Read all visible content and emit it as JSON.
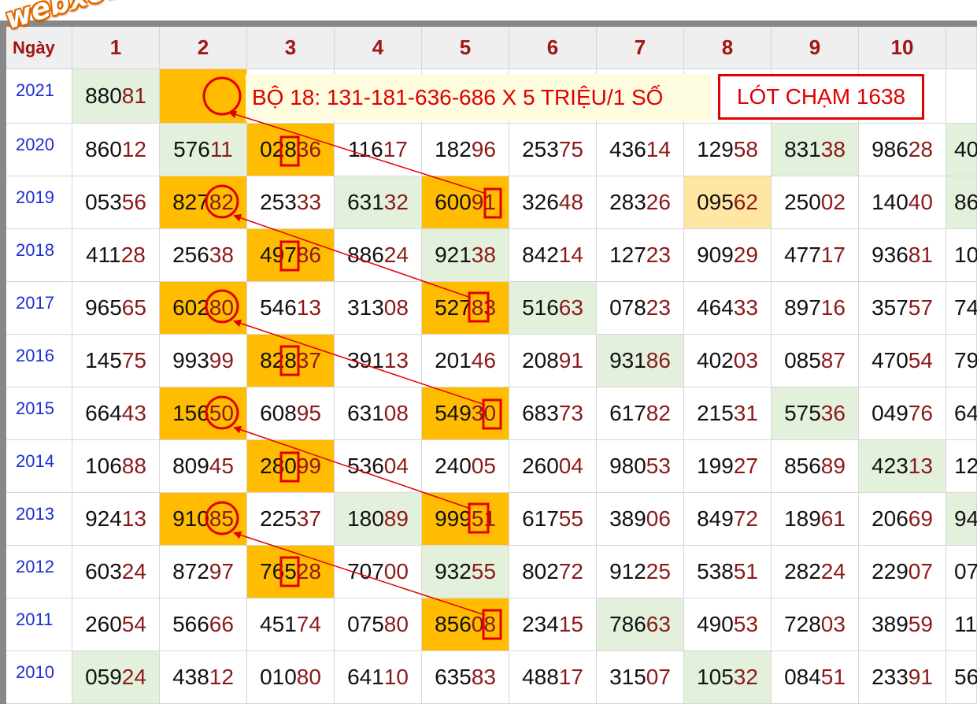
{
  "watermark": "webxoso.net",
  "header": {
    "corner": "Ngày",
    "columns": [
      "1",
      "2",
      "3",
      "4",
      "5",
      "6",
      "7",
      "8",
      "9",
      "10"
    ]
  },
  "banner": {
    "text": "BỘ 18: 131-181-636-686 X 5 TRIỆU/1 SỐ",
    "lot": "LÓT CHẠM 1638"
  },
  "rows": [
    {
      "year": "2021",
      "cells": [
        "88081",
        "",
        "",
        "",
        "",
        "",
        "",
        "",
        "",
        ""
      ],
      "partial": ""
    },
    {
      "year": "2020",
      "cells": [
        "86012",
        "57611",
        "02836",
        "11617",
        "18296",
        "25375",
        "43614",
        "12958",
        "83138",
        "98628"
      ],
      "partial": "40"
    },
    {
      "year": "2019",
      "cells": [
        "05356",
        "82782",
        "25333",
        "63132",
        "60091",
        "32648",
        "28326",
        "09562",
        "25002",
        "14040"
      ],
      "partial": "86"
    },
    {
      "year": "2018",
      "cells": [
        "41128",
        "25638",
        "49786",
        "88624",
        "92138",
        "84214",
        "12723",
        "90929",
        "47717",
        "93681"
      ],
      "partial": "10"
    },
    {
      "year": "2017",
      "cells": [
        "96565",
        "60280",
        "54613",
        "31308",
        "52783",
        "51663",
        "07823",
        "46433",
        "89716",
        "35757"
      ],
      "partial": "74"
    },
    {
      "year": "2016",
      "cells": [
        "14575",
        "99399",
        "82837",
        "39113",
        "20146",
        "20891",
        "93186",
        "40203",
        "08587",
        "47054"
      ],
      "partial": "79"
    },
    {
      "year": "2015",
      "cells": [
        "66443",
        "15650",
        "60895",
        "63108",
        "54930",
        "68373",
        "61782",
        "21531",
        "57536",
        "04976"
      ],
      "partial": "64"
    },
    {
      "year": "2014",
      "cells": [
        "10688",
        "80945",
        "28099",
        "53604",
        "24005",
        "26004",
        "98053",
        "19927",
        "85689",
        "42313"
      ],
      "partial": "12"
    },
    {
      "year": "2013",
      "cells": [
        "92413",
        "91085",
        "22537",
        "18089",
        "99951",
        "61755",
        "38906",
        "84972",
        "18961",
        "20669"
      ],
      "partial": "94"
    },
    {
      "year": "2012",
      "cells": [
        "60324",
        "87297",
        "76528",
        "70700",
        "93255",
        "80272",
        "91225",
        "53851",
        "28224",
        "22907"
      ],
      "partial": "07"
    },
    {
      "year": "2011",
      "cells": [
        "26054",
        "56666",
        "45174",
        "07580",
        "85608",
        "23415",
        "78663",
        "49053",
        "72803",
        "38959"
      ],
      "partial": "11"
    },
    {
      "year": "2010",
      "cells": [
        "05924",
        "43812",
        "01080",
        "64110",
        "63583",
        "48817",
        "31507",
        "10532",
        "08451",
        "23391"
      ],
      "partial": "56"
    }
  ],
  "colors": {
    "highlight_orange": "#ffbc00",
    "highlight_green": "#e3f1dc",
    "highlight_light_orange": "#ffe7a3",
    "header_text": "#a01515",
    "year_text": "#1a2fd0",
    "annotation_red": "#e00000"
  },
  "cell_backgrounds": [
    [
      "green",
      "orange",
      "",
      "",
      "",
      "",
      "",
      "",
      "",
      ""
    ],
    [
      "",
      "green",
      "orange",
      "",
      "",
      "",
      "",
      "",
      "green",
      ""
    ],
    [
      "",
      "orange",
      "",
      "green",
      "orange",
      "",
      "",
      "lightorange",
      "",
      ""
    ],
    [
      "",
      "",
      "orange",
      "",
      "green",
      "",
      "",
      "",
      "",
      ""
    ],
    [
      "",
      "orange",
      "",
      "",
      "orange",
      "green",
      "",
      "",
      "",
      ""
    ],
    [
      "",
      "",
      "orange",
      "",
      "",
      "",
      "green",
      "",
      "",
      ""
    ],
    [
      "",
      "orange",
      "",
      "",
      "orange",
      "",
      "",
      "",
      "green",
      ""
    ],
    [
      "",
      "",
      "orange",
      "",
      "",
      "",
      "",
      "",
      "",
      "green"
    ],
    [
      "",
      "orange",
      "",
      "green",
      "orange",
      "",
      "",
      "",
      "",
      ""
    ],
    [
      "",
      "",
      "orange",
      "",
      "green",
      "",
      "",
      "",
      "",
      ""
    ],
    [
      "",
      "",
      "",
      "",
      "orange",
      "",
      "green",
      "",
      "",
      ""
    ],
    [
      "green",
      "",
      "",
      "",
      "",
      "",
      "",
      "green",
      "",
      ""
    ]
  ],
  "partial_backgrounds": [
    "",
    "green",
    "green",
    "",
    "",
    "",
    "",
    "",
    "green",
    "",
    "",
    ""
  ]
}
